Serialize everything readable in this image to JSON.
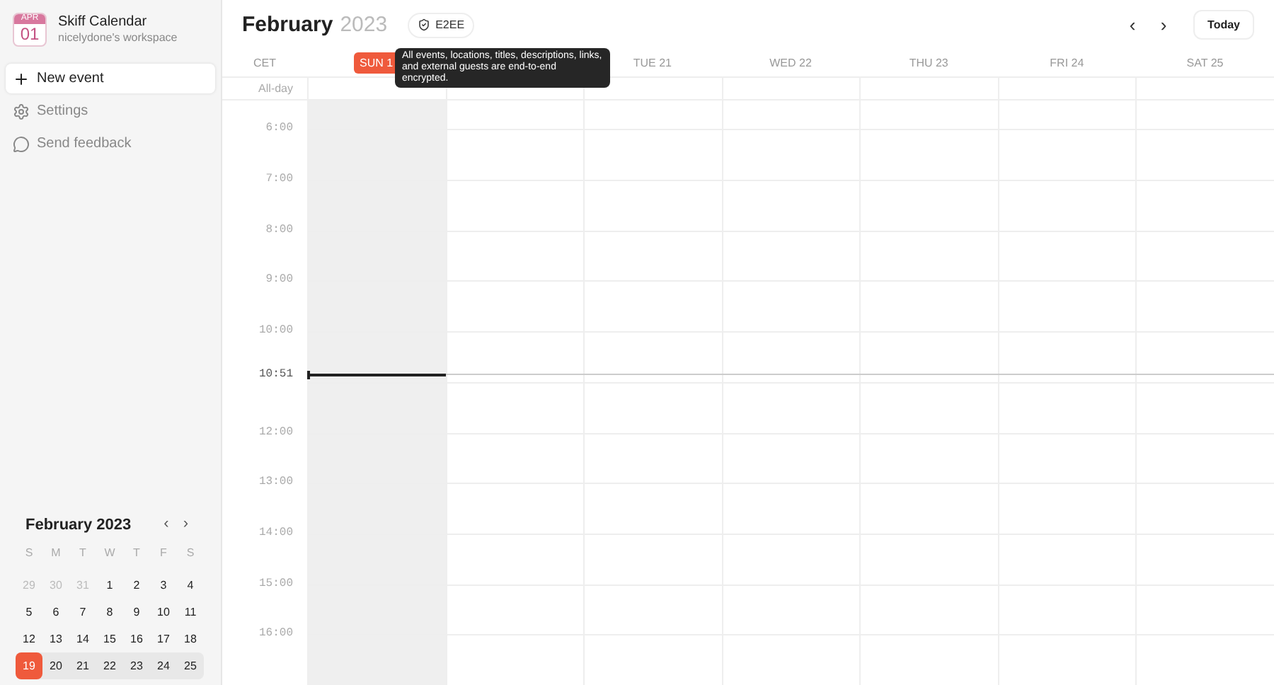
{
  "app": {
    "logo_month": "APR",
    "logo_day": "01",
    "name": "Skiff Calendar",
    "workspace": "nicelydone's workspace"
  },
  "nav": [
    {
      "kind": "plus",
      "label": "New event",
      "selected": true
    },
    {
      "kind": "gear",
      "label": "Settings",
      "selected": false
    },
    {
      "kind": "feedback",
      "label": "Send feedback",
      "selected": false
    }
  ],
  "mini_calendar": {
    "title": "February 2023",
    "prev": "‹",
    "next": "›",
    "weekdays": [
      "S",
      "M",
      "T",
      "W",
      "T",
      "F",
      "S"
    ],
    "weeks": [
      {
        "current": false,
        "days": [
          {
            "label": "29",
            "muted": true,
            "selected": false
          },
          {
            "label": "30",
            "muted": true,
            "selected": false
          },
          {
            "label": "31",
            "muted": true,
            "selected": false
          },
          {
            "label": "1",
            "muted": false,
            "selected": false
          },
          {
            "label": "2",
            "muted": false,
            "selected": false
          },
          {
            "label": "3",
            "muted": false,
            "selected": false
          },
          {
            "label": "4",
            "muted": false,
            "selected": false
          }
        ]
      },
      {
        "current": false,
        "days": [
          {
            "label": "5",
            "muted": false,
            "selected": false
          },
          {
            "label": "6",
            "muted": false,
            "selected": false
          },
          {
            "label": "7",
            "muted": false,
            "selected": false
          },
          {
            "label": "8",
            "muted": false,
            "selected": false
          },
          {
            "label": "9",
            "muted": false,
            "selected": false
          },
          {
            "label": "10",
            "muted": false,
            "selected": false
          },
          {
            "label": "11",
            "muted": false,
            "selected": false
          }
        ]
      },
      {
        "current": false,
        "days": [
          {
            "label": "12",
            "muted": false,
            "selected": false
          },
          {
            "label": "13",
            "muted": false,
            "selected": false
          },
          {
            "label": "14",
            "muted": false,
            "selected": false
          },
          {
            "label": "15",
            "muted": false,
            "selected": false
          },
          {
            "label": "16",
            "muted": false,
            "selected": false
          },
          {
            "label": "17",
            "muted": false,
            "selected": false
          },
          {
            "label": "18",
            "muted": false,
            "selected": false
          }
        ]
      },
      {
        "current": true,
        "days": [
          {
            "label": "19",
            "muted": false,
            "selected": true
          },
          {
            "label": "20",
            "muted": false,
            "selected": false
          },
          {
            "label": "21",
            "muted": false,
            "selected": false
          },
          {
            "label": "22",
            "muted": false,
            "selected": false
          },
          {
            "label": "23",
            "muted": false,
            "selected": false
          },
          {
            "label": "24",
            "muted": false,
            "selected": false
          },
          {
            "label": "25",
            "muted": false,
            "selected": false
          }
        ]
      }
    ]
  },
  "header": {
    "month": "February",
    "year": "2023",
    "badge": "E2EE",
    "tooltip": "All events, locations, titles, descriptions, links, and external guests are end-to-end encrypted.",
    "prev": "‹",
    "next": "›",
    "today": "Today"
  },
  "timezone": "CET",
  "all_day": "All-day",
  "days": [
    {
      "label": "SUN 1",
      "selected": true,
      "shaded": true
    },
    {
      "shaded": false
    },
    {
      "label": "TUE 21",
      "selected": false,
      "shaded": false
    },
    {
      "label": "WED 22",
      "selected": false,
      "shaded": false
    },
    {
      "label": "THU 23",
      "selected": false,
      "shaded": false
    },
    {
      "label": "FRI 24",
      "selected": false,
      "shaded": false
    },
    {
      "label": "SAT 25",
      "selected": false,
      "shaded": false
    }
  ],
  "hours": [
    {
      "kind": "hour",
      "label": "6:00"
    },
    {
      "kind": "hour",
      "label": "7:00"
    },
    {
      "kind": "hour",
      "label": "8:00"
    },
    {
      "kind": "hour",
      "label": "9:00"
    },
    {
      "kind": "hour",
      "label": "10:00"
    },
    {
      "kind": "now",
      "label": "10:51"
    },
    {
      "kind": "hour",
      "label": "12:00"
    },
    {
      "kind": "hour",
      "label": "13:00"
    },
    {
      "kind": "hour",
      "label": "14:00"
    },
    {
      "kind": "hour",
      "label": "15:00"
    },
    {
      "kind": "hour",
      "label": "16:00"
    }
  ]
}
